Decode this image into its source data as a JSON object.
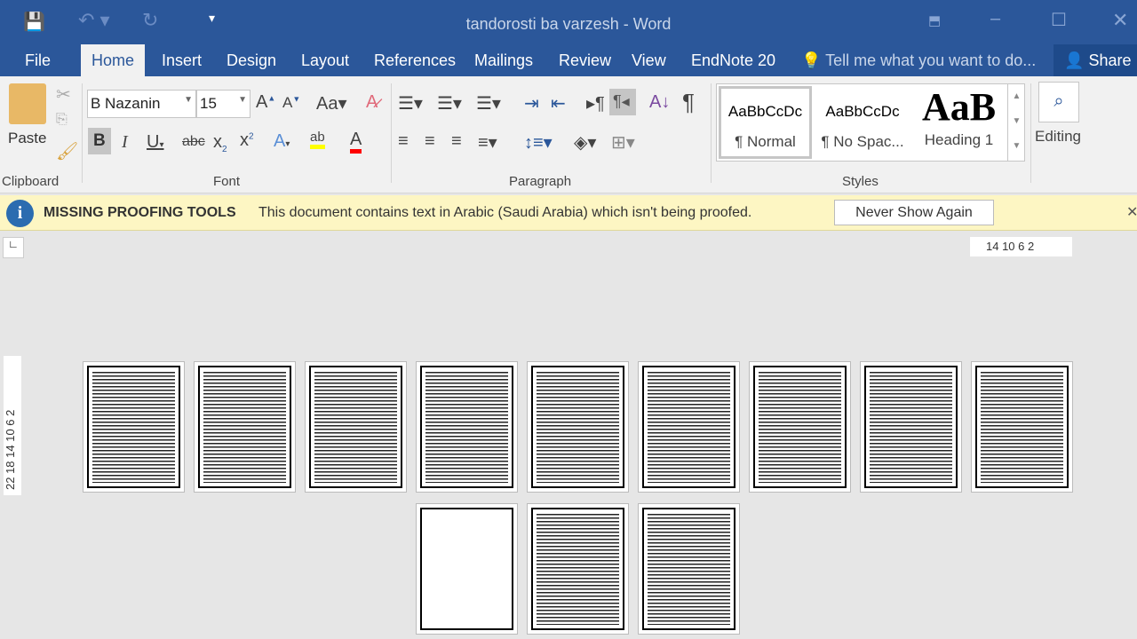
{
  "window": {
    "title": "tandorosti ba varzesh - Word"
  },
  "tabs": [
    "File",
    "Home",
    "Insert",
    "Design",
    "Layout",
    "References",
    "Mailings",
    "Review",
    "View",
    "EndNote 20"
  ],
  "tell_me": "Tell me what you want to do...",
  "share": "Share",
  "ribbon": {
    "clipboard": {
      "paste": "Paste",
      "label": "Clipboard"
    },
    "font": {
      "name": "B Nazanin",
      "size": "15",
      "label": "Font",
      "change_case": "Aa"
    },
    "paragraph": {
      "label": "Paragraph"
    },
    "styles": {
      "label": "Styles",
      "items": [
        {
          "preview": "AaBbCcDc",
          "name": "¶ Normal"
        },
        {
          "preview": "AaBbCcDc",
          "name": "¶ No Spac..."
        },
        {
          "preview": "AaB",
          "name": "Heading 1"
        }
      ]
    },
    "editing": {
      "label": "Editing"
    }
  },
  "message_bar": {
    "title": "MISSING PROOFING TOOLS",
    "text": "This document contains text in Arabic (Saudi Arabia) which isn't being proofed.",
    "button": "Never Show Again"
  },
  "ruler": {
    "horizontal": "14  10  6   2",
    "vertical": "22 18 14 10  6   2"
  },
  "pages": {
    "row1": 9,
    "row2": 3
  },
  "colors": {
    "brand": "#2b579a",
    "highlight": "#ffff00",
    "font_color": "#ff0000"
  }
}
